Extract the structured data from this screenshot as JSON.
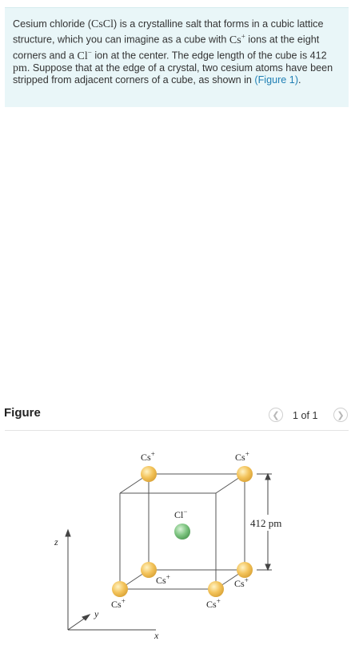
{
  "problem": {
    "p1": "Cesium chloride (",
    "formula": "CsCl",
    "p2": ") is a crystalline salt that forms in a cubic lattice structure, which you can imagine as a cube with ",
    "cs_ion": "Cs",
    "cs_charge": "+",
    "p3": " ions at the eight corners and a ",
    "cl_ion": "Cl",
    "cl_charge": "−",
    "p4": " ion at the center. The edge length of the cube is 412 ",
    "unit": "pm",
    "p5": ". Suppose that at the edge of a crystal, two cesium atoms have been stripped from adjacent corners of a cube, as shown in ",
    "figure_link": "(Figure 1)",
    "p6": "."
  },
  "figure_panel": {
    "title": "Figure",
    "pager": "1 of 1",
    "prev_icon": "chevron-left-icon",
    "next_icon": "chevron-right-icon"
  },
  "diagram": {
    "cs_label": "Cs",
    "cs_charge": "+",
    "cl_label": "Cl",
    "cl_charge": "−",
    "edge_length": "412 pm",
    "axis_z": "z",
    "axis_y": "y",
    "axis_x": "x",
    "colors": {
      "cs_atom": "#f3c35a",
      "cl_atom": "#7fc582",
      "cube_line": "#555555"
    }
  }
}
